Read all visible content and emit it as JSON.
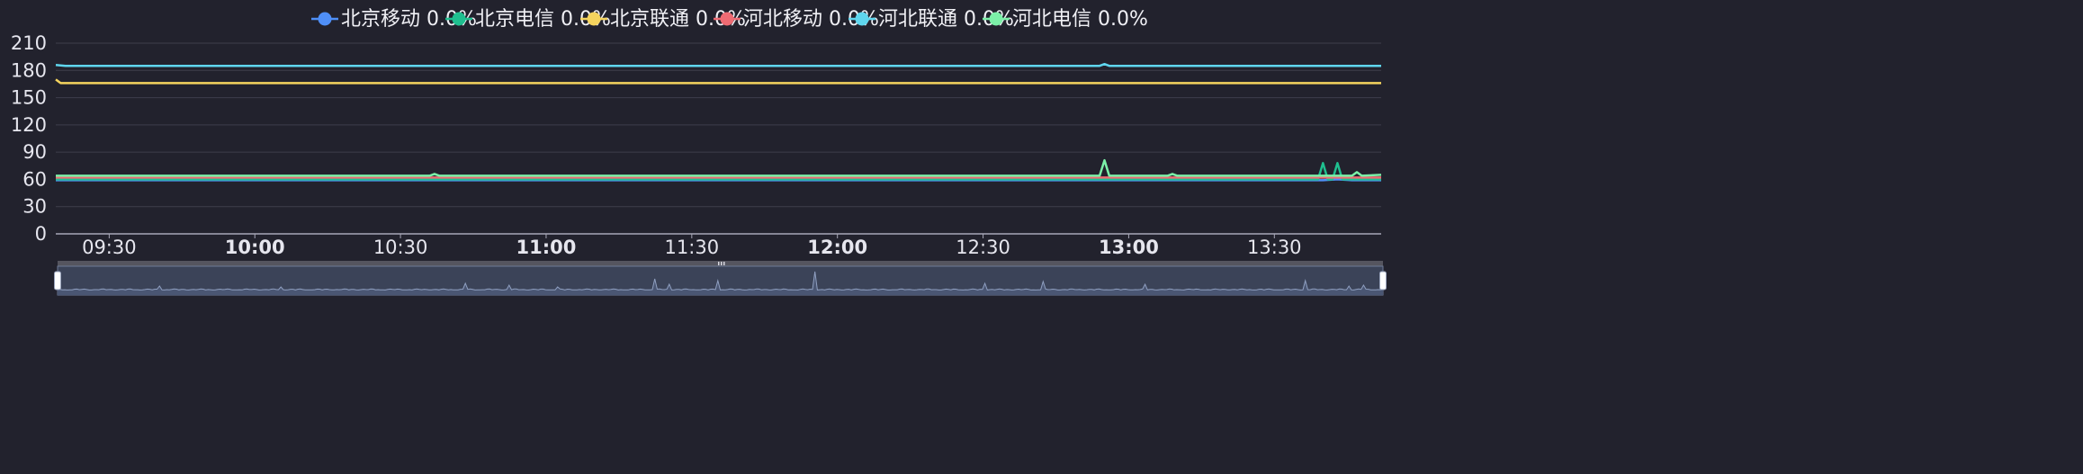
{
  "chart_data": {
    "type": "line",
    "legend_position": "top-center",
    "grid": true,
    "ylim": [
      0,
      210
    ],
    "yticks": [
      "0",
      "30",
      "60",
      "90",
      "120",
      "150",
      "180",
      "210"
    ],
    "x_start": "09:19",
    "x_end": "13:52",
    "xticks": [
      {
        "label": "09:30",
        "bold": false
      },
      {
        "label": "10:00",
        "bold": true
      },
      {
        "label": "10:30",
        "bold": false
      },
      {
        "label": "11:00",
        "bold": true
      },
      {
        "label": "11:30",
        "bold": false
      },
      {
        "label": "12:00",
        "bold": true
      },
      {
        "label": "12:30",
        "bold": false
      },
      {
        "label": "13:00",
        "bold": true
      },
      {
        "label": "13:30",
        "bold": false
      }
    ],
    "series": [
      {
        "name": "北京移动",
        "loss": "0.0%",
        "color": "#4f8ff7",
        "base": 59,
        "points": [
          [
            "09:19",
            59
          ],
          [
            "13:40",
            59
          ],
          [
            "13:43",
            60
          ],
          [
            "13:46",
            59
          ],
          [
            "13:52",
            59
          ]
        ]
      },
      {
        "name": "北京电信",
        "loss": "0.0%",
        "color": "#1fbf8f",
        "base": 60,
        "points": [
          [
            "09:19",
            60
          ],
          [
            "13:39",
            60
          ],
          [
            "13:40",
            78
          ],
          [
            "13:41",
            60
          ],
          [
            "13:42",
            60
          ],
          [
            "13:43",
            78
          ],
          [
            "13:44",
            60
          ],
          [
            "13:52",
            60
          ]
        ]
      },
      {
        "name": "北京联通",
        "loss": "0.0%",
        "color": "#f5d45e",
        "base": 165,
        "points": [
          [
            "09:19",
            170
          ],
          [
            "09:20",
            166
          ],
          [
            "13:52",
            166
          ]
        ]
      },
      {
        "name": "河北移动",
        "loss": "0.0%",
        "color": "#ef6b73",
        "base": 62,
        "points": [
          [
            "09:19",
            62
          ],
          [
            "13:52",
            62
          ]
        ]
      },
      {
        "name": "河北联通",
        "loss": "0.0%",
        "color": "#5fd6ee",
        "base": 185,
        "points": [
          [
            "09:19",
            186
          ],
          [
            "09:21",
            185
          ],
          [
            "12:54",
            185
          ],
          [
            "12:55",
            187
          ],
          [
            "12:56",
            185
          ],
          [
            "13:52",
            185
          ]
        ]
      },
      {
        "name": "河北电信",
        "loss": "0.0%",
        "color": "#7cf0a8",
        "base": 64,
        "points": [
          [
            "09:19",
            64
          ],
          [
            "10:36",
            64
          ],
          [
            "10:37",
            66
          ],
          [
            "10:38",
            64
          ],
          [
            "12:54",
            64
          ],
          [
            "12:55",
            81
          ],
          [
            "12:56",
            64
          ],
          [
            "13:08",
            64
          ],
          [
            "13:09",
            66
          ],
          [
            "13:10",
            64
          ],
          [
            "13:46",
            64
          ],
          [
            "13:47",
            68
          ],
          [
            "13:48",
            64
          ],
          [
            "13:52",
            65
          ]
        ]
      }
    ]
  },
  "zoom": {
    "start_fraction": 0,
    "end_fraction": 1
  },
  "colors": {
    "background": "#22222d",
    "grid": "#3e3e4c",
    "axis": "#a8a8b8",
    "zoom_fill": "#3b4358",
    "zoom_line": "#8f9fc0"
  }
}
